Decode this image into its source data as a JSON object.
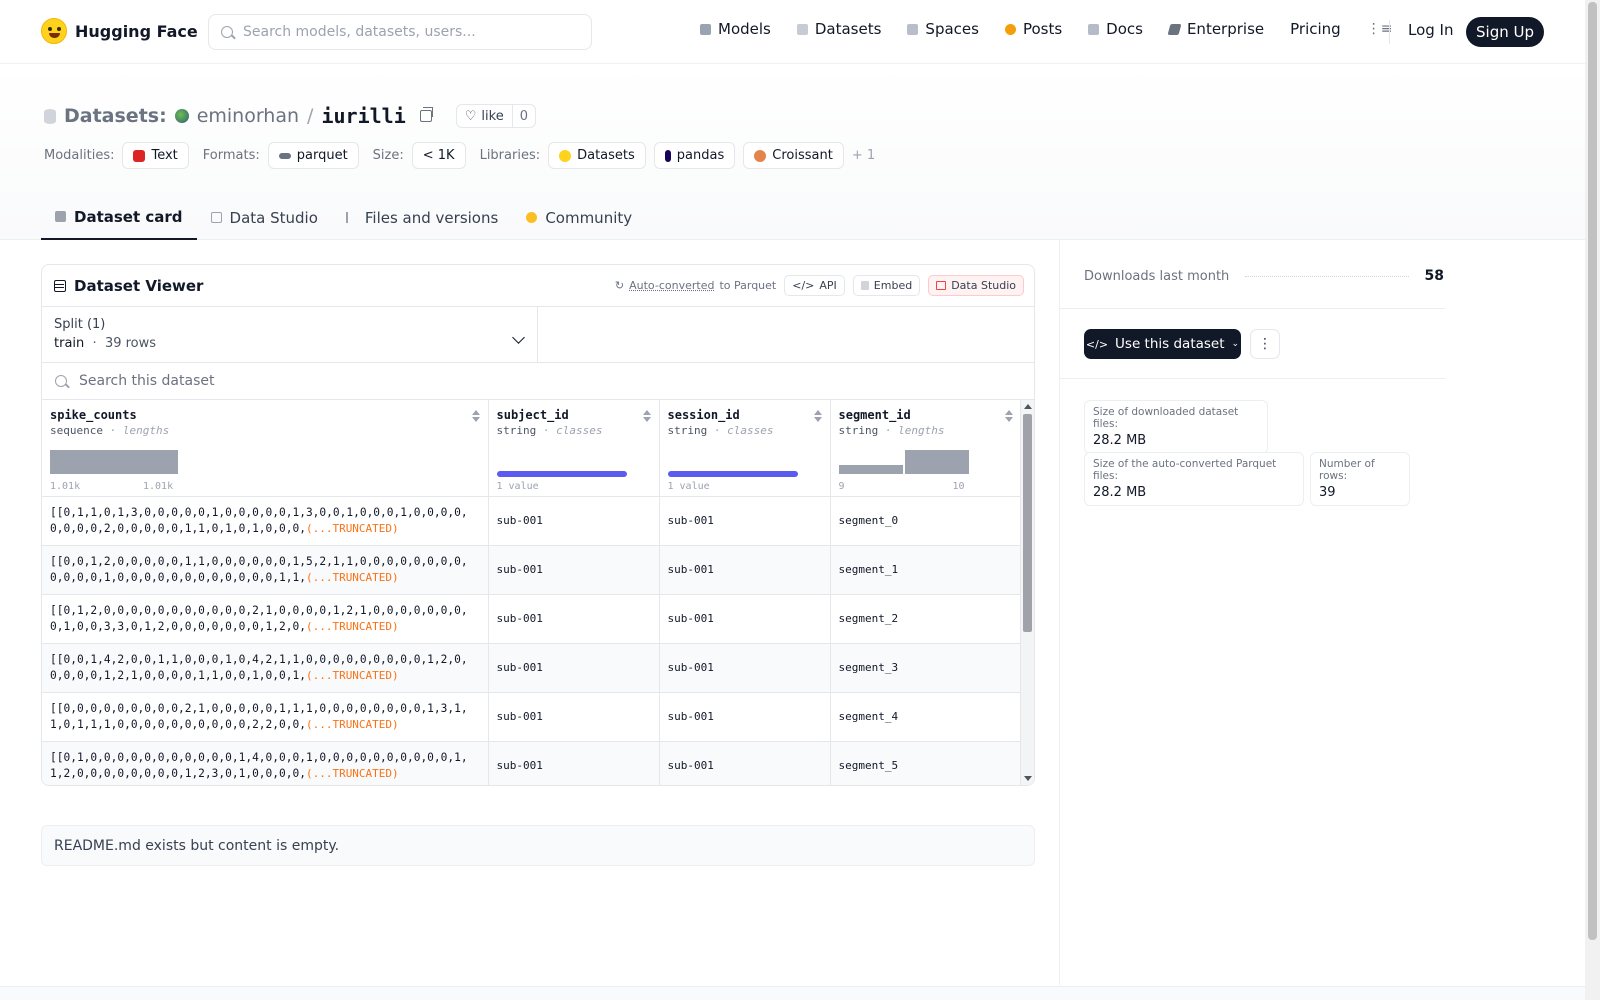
{
  "header": {
    "brand": "Hugging Face",
    "search_placeholder": "Search models, datasets, users...",
    "nav": [
      "Models",
      "Datasets",
      "Spaces",
      "Posts",
      "Docs",
      "Enterprise",
      "Pricing"
    ],
    "login": "Log In",
    "signup": "Sign Up"
  },
  "repo": {
    "type_label": "Datasets:",
    "owner": "eminorhan",
    "name": "iurilli",
    "like_label": "like",
    "like_count": "0",
    "tags": {
      "modalities_label": "Modalities:",
      "modalities": [
        "Text"
      ],
      "formats_label": "Formats:",
      "formats": [
        "parquet"
      ],
      "size_label": "Size:",
      "size": "< 1K",
      "libraries_label": "Libraries:",
      "libraries": [
        "Datasets",
        "pandas",
        "Croissant"
      ],
      "more": "+ 1"
    },
    "tabs": [
      "Dataset card",
      "Data Studio",
      "Files and versions",
      "Community"
    ]
  },
  "viewer": {
    "title": "Dataset Viewer",
    "auto_converted": "Auto-converted",
    "to_parquet": "to Parquet",
    "api": "API",
    "embed": "Embed",
    "data_studio": "Data Studio",
    "split_label": "Split (1)",
    "split_name": "train",
    "split_rows": "39 rows",
    "search_placeholder": "Search this dataset",
    "columns": [
      {
        "name": "spike_counts",
        "type": "sequence",
        "stat": "lengths",
        "axis_min": "1.01k",
        "axis_max": "1.01k"
      },
      {
        "name": "subject_id",
        "type": "string",
        "stat": "classes",
        "axis_min": "1 value",
        "fraction": 1.0
      },
      {
        "name": "session_id",
        "type": "string",
        "stat": "classes",
        "axis_min": "1 value",
        "fraction": 1.0
      },
      {
        "name": "segment_id",
        "type": "string",
        "stat": "lengths",
        "axis_min": "9",
        "axis_max": "10"
      }
    ],
    "truncated": "(...TRUNCATED)",
    "rows": [
      {
        "spike": "[[0,1,1,0,1,3,0,0,0,0,0,1,0,0,0,0,0,1,3,0,0,1,0,0,0,1,0,0,0,0,0,0,0,0,2,0,0,0,0,0,1,1,0,1,0,1,0,0,0,",
        "subject": "sub-001",
        "session": "sub-001",
        "segment": "segment_0"
      },
      {
        "spike": "[[0,0,1,2,0,0,0,0,0,1,1,0,0,0,0,0,0,1,5,2,1,1,0,0,0,0,0,0,0,0,0,0,0,0,1,0,0,0,0,0,0,0,0,0,0,0,0,1,1,",
        "subject": "sub-001",
        "session": "sub-001",
        "segment": "segment_1"
      },
      {
        "spike": "[[0,1,2,0,0,0,0,0,0,0,0,0,0,0,2,1,0,0,0,0,1,2,1,0,0,0,0,0,0,0,0,1,0,0,3,3,0,1,2,0,0,0,0,0,0,0,1,2,0,",
        "subject": "sub-001",
        "session": "sub-001",
        "segment": "segment_2"
      },
      {
        "spike": "[[0,0,1,4,2,0,0,1,1,0,0,0,1,0,4,2,1,1,0,0,0,0,0,0,0,0,0,1,2,0,0,0,0,0,1,2,1,0,0,0,0,1,1,0,0,1,0,0,1,",
        "subject": "sub-001",
        "session": "sub-001",
        "segment": "segment_3"
      },
      {
        "spike": "[[0,0,0,0,0,0,0,0,0,2,1,0,0,0,0,0,1,1,1,0,0,0,0,0,0,0,0,1,3,1,1,0,1,1,1,0,0,0,0,0,0,0,0,0,0,2,2,0,0,",
        "subject": "sub-001",
        "session": "sub-001",
        "segment": "segment_4"
      },
      {
        "spike": "[[0,1,0,0,0,0,0,0,0,0,0,0,0,1,4,0,0,0,1,0,0,0,0,0,0,0,0,0,0,1,1,2,0,0,0,0,0,0,0,0,1,2,3,0,1,0,0,0,0,",
        "subject": "sub-001",
        "session": "sub-001",
        "segment": "segment_5"
      }
    ]
  },
  "readme": "README.md exists but content is empty.",
  "sidebar": {
    "downloads_label": "Downloads last month",
    "downloads": "58",
    "use_dataset": "Use this dataset",
    "size_downloaded_label": "Size of downloaded dataset files:",
    "size_downloaded": "28.2 MB",
    "size_parquet_label": "Size of the auto-converted Parquet files:",
    "size_parquet": "28.2 MB",
    "rows_label": "Number of rows:",
    "rows": "39"
  },
  "colors": {
    "accent": "#5b5bf0",
    "truncated": "#f97316",
    "signup_bg": "#111827"
  }
}
